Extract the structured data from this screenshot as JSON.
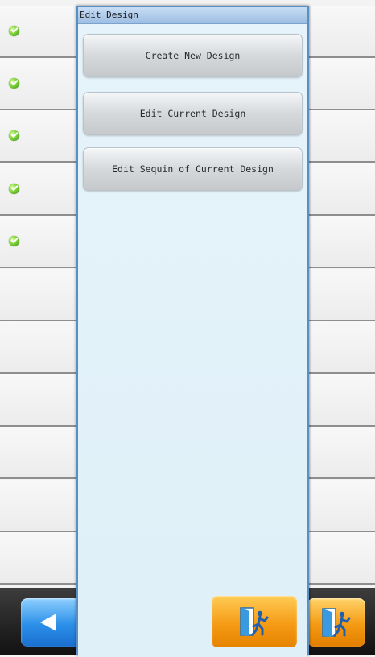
{
  "dialog": {
    "title": "Edit Design",
    "buttons": [
      {
        "label": "Create New Design"
      },
      {
        "label": "Edit Current Design"
      },
      {
        "label": "Edit Sequin of Current Design"
      }
    ],
    "exit_icon": "exit-door-icon"
  },
  "background_list": {
    "rows": [
      {
        "status_icon": "check-icon"
      },
      {
        "status_icon": "check-icon"
      },
      {
        "status_icon": "check-icon"
      },
      {
        "status_icon": "check-icon"
      },
      {
        "status_icon": "check-icon"
      },
      {
        "status_icon": ""
      },
      {
        "status_icon": ""
      },
      {
        "status_icon": ""
      },
      {
        "status_icon": ""
      },
      {
        "status_icon": ""
      },
      {
        "status_icon": ""
      }
    ]
  },
  "bottom_bar": {
    "back_icon": "arrow-left-icon",
    "exit_icon": "exit-door-icon"
  },
  "colors": {
    "accent_blue": "#2b8fe8",
    "accent_orange": "#f39a12",
    "dialog_border": "#5a8fc4",
    "dialog_bg": "#eaf5fb",
    "status_green": "#7fd23a"
  }
}
